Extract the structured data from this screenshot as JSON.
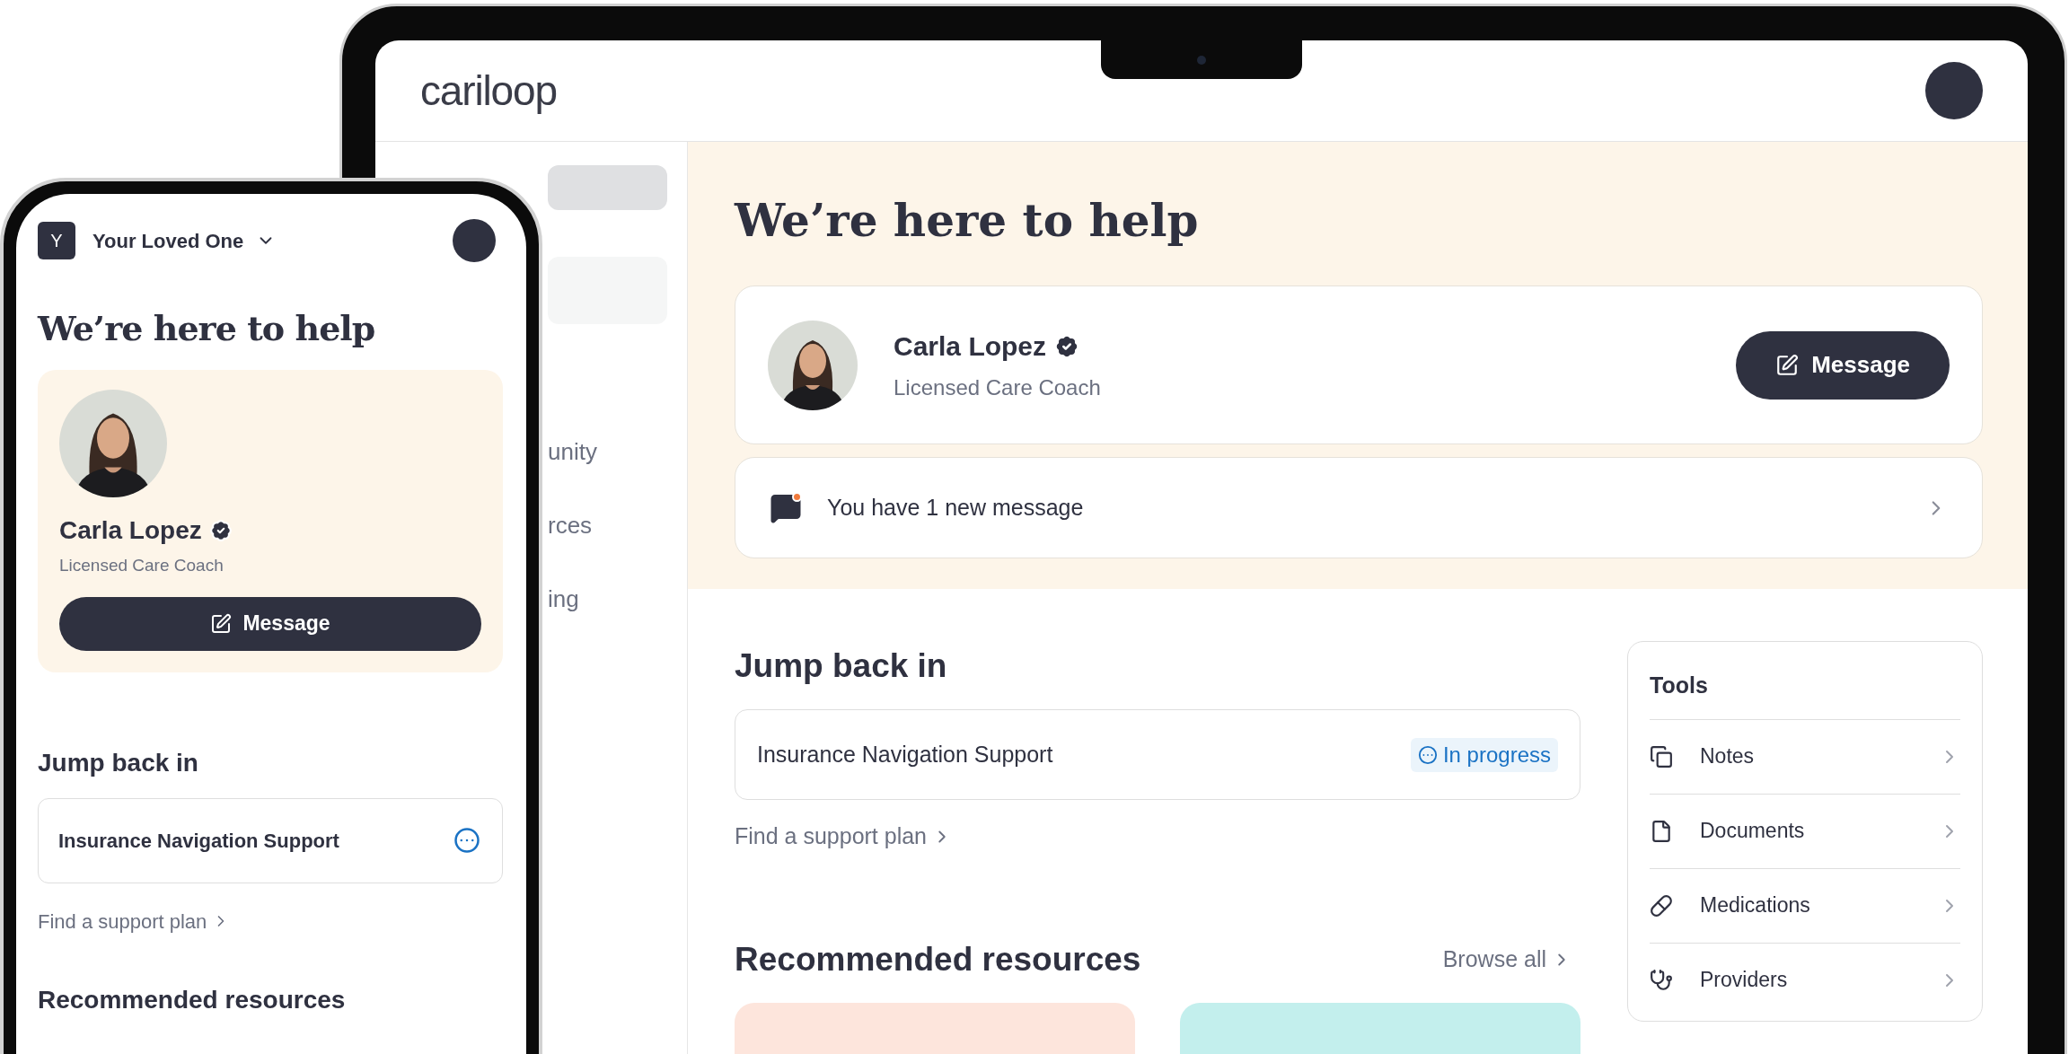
{
  "laptop": {
    "logo": "cariloop",
    "sidebar": {
      "items": [
        {
          "label": "unity"
        },
        {
          "label": "rces"
        },
        {
          "label": "ing"
        }
      ]
    },
    "hero": {
      "title": "We’re here to help",
      "coach": {
        "name": "Carla Lopez",
        "role": "Licensed Care Coach",
        "button": "Message"
      },
      "notice": {
        "text": "You have 1 new message"
      }
    },
    "jump_back_in": {
      "title": "Jump back in",
      "plan": {
        "name": "Insurance Navigation Support",
        "status": "In progress"
      },
      "link": "Find a support plan"
    },
    "resources": {
      "title": "Recommended resources",
      "browse": "Browse all",
      "cards": [
        {
          "color": "#fde5dc"
        },
        {
          "color": "#c3efed"
        }
      ]
    },
    "tools": {
      "title": "Tools",
      "items": [
        {
          "label": "Notes",
          "kind": "notes"
        },
        {
          "label": "Documents",
          "kind": "document"
        },
        {
          "label": "Medications",
          "kind": "pill"
        },
        {
          "label": "Providers",
          "kind": "stethoscope"
        }
      ]
    }
  },
  "phone": {
    "profile": {
      "initial": "Y",
      "name": "Your Loved One"
    },
    "title": "We’re here to help",
    "coach": {
      "name": "Carla Lopez",
      "role": "Licensed Care Coach",
      "button": "Message"
    },
    "jump_back_in": {
      "title": "Jump back in",
      "plan": {
        "name": "Insurance Navigation Support"
      },
      "link": "Find a support plan"
    },
    "resources": {
      "title": "Recommended resources"
    }
  }
}
